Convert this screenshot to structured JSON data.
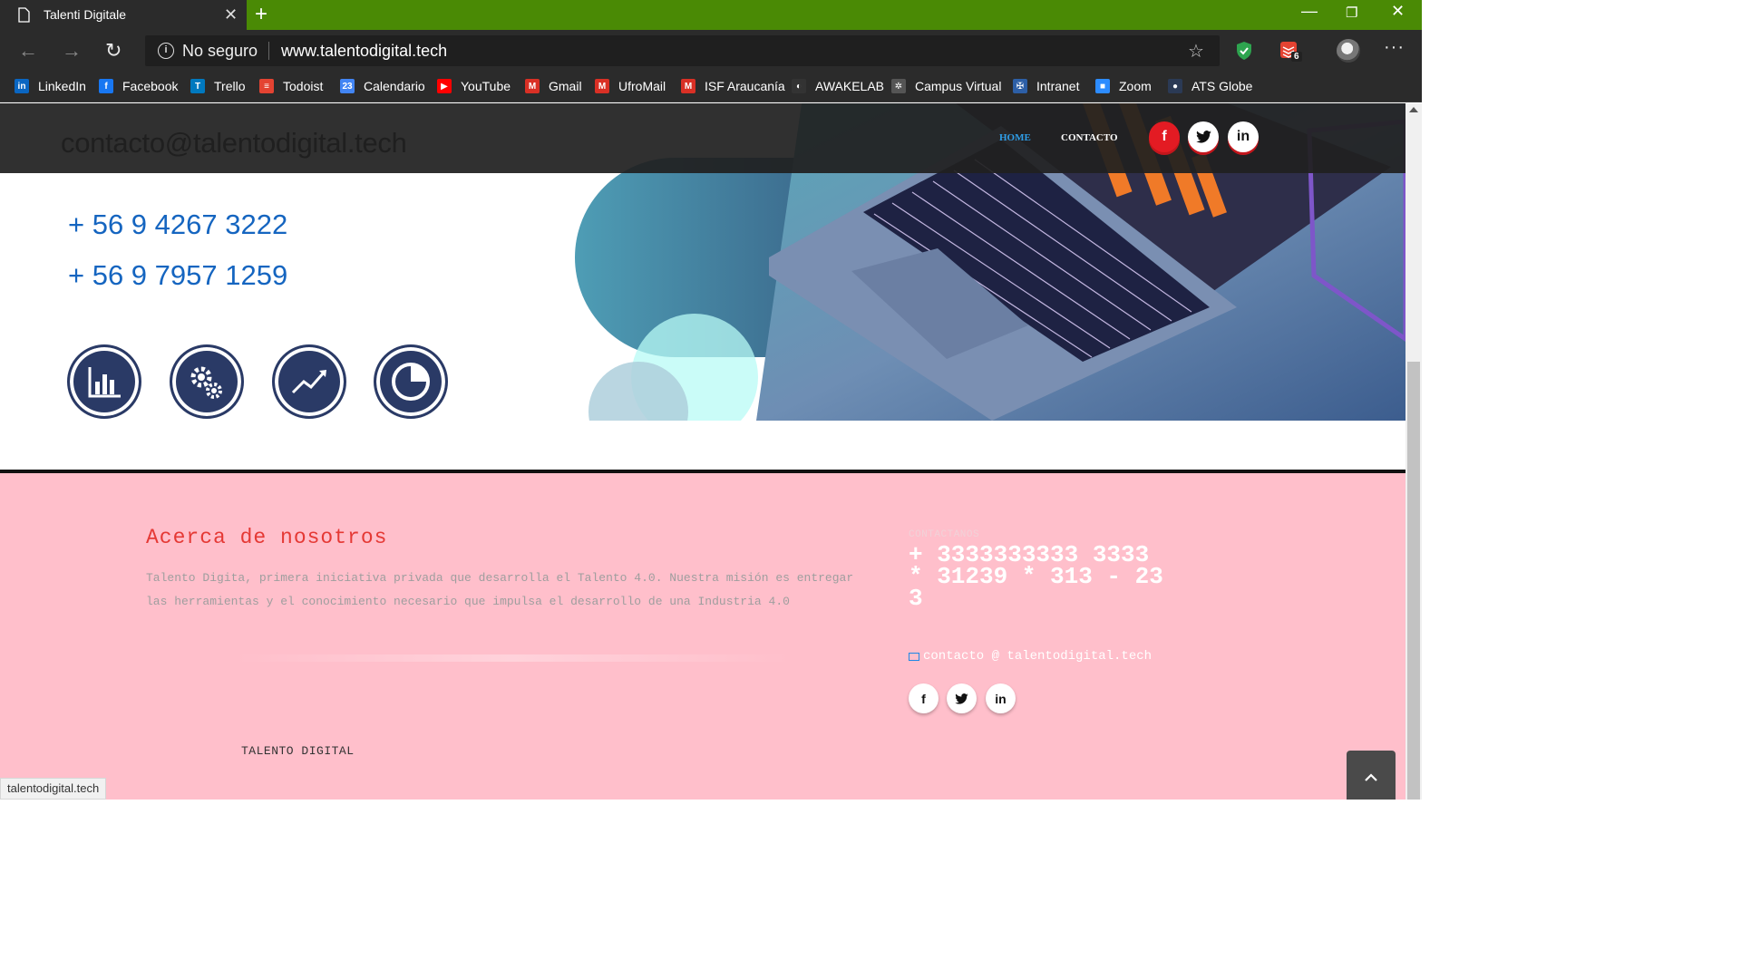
{
  "browser": {
    "tab_title": "Talenti Digitale",
    "address_security": "No seguro",
    "address_url": "www.talentodigital.tech",
    "extension_badge": "6",
    "status_url": "talentodigital.tech"
  },
  "bookmarks": [
    {
      "label": "LinkedIn",
      "icon": "linkedin-icon",
      "color": "#0a66c2",
      "glyph": "in"
    },
    {
      "label": "Facebook",
      "icon": "facebook-icon",
      "color": "#1877f2",
      "glyph": "f"
    },
    {
      "label": "Trello",
      "icon": "trello-icon",
      "color": "#0079bf",
      "glyph": "T"
    },
    {
      "label": "Todoist",
      "icon": "todoist-icon",
      "color": "#e44332",
      "glyph": "≡"
    },
    {
      "label": "Calendario",
      "icon": "calendar-icon",
      "color": "#4285f4",
      "glyph": "23"
    },
    {
      "label": "YouTube",
      "icon": "youtube-icon",
      "color": "#ff0000",
      "glyph": "▶"
    },
    {
      "label": "Gmail",
      "icon": "gmail-icon",
      "color": "#d93025",
      "glyph": "M"
    },
    {
      "label": "UfroMail",
      "icon": "gmail-icon",
      "color": "#d93025",
      "glyph": "M"
    },
    {
      "label": "ISF Araucanía",
      "icon": "gmail-icon",
      "color": "#d93025",
      "glyph": "M"
    },
    {
      "label": "AWAKELAB",
      "icon": "awakelab-icon",
      "color": "#333333",
      "glyph": "◐"
    },
    {
      "label": "Campus Virtual",
      "icon": "campus-icon",
      "color": "#555555",
      "glyph": "✲"
    },
    {
      "label": "Intranet",
      "icon": "intranet-icon",
      "color": "#2d5fa6",
      "glyph": "✠"
    },
    {
      "label": "Zoom",
      "icon": "zoom-icon",
      "color": "#2d8cff",
      "glyph": "■"
    },
    {
      "label": "ATS Globe",
      "icon": "globe-icon",
      "color": "#2b3a55",
      "glyph": "●"
    }
  ],
  "page": {
    "header_email": "contacto@talentodigital.tech",
    "nav_home": "HOME",
    "nav_contact": "CONTACTO",
    "social": [
      "f",
      "t",
      "in"
    ],
    "phones": [
      "+ 56 9 4267 3222",
      "+ 56 9 7957 1259"
    ],
    "feature_icons": [
      "bar-chart-icon",
      "gears-icon",
      "trend-up-icon",
      "pie-clock-icon"
    ]
  },
  "footer": {
    "about_title": "Acerca de nosotros",
    "about_text": "Talento Digita, primera iniciativa privada que desarrolla el Talento 4.0. Nuestra misión es entregar las herramientas y el conocimiento necesario que impulsa el desarrollo de una Industria 4.0",
    "brand": "TALENTO DIGITAL",
    "contact_label": "CONTACTANOS",
    "contact_phone": "+ 3333333333 3333 * 31239 * 313 - 233",
    "contact_email": "contacto @ talentodigital.tech"
  },
  "colors": {
    "chrome_accent": "#4a8a05",
    "footer_bg": "#ffbfcb",
    "phone_blue": "#1565c0",
    "social_red": "#e31b23"
  }
}
